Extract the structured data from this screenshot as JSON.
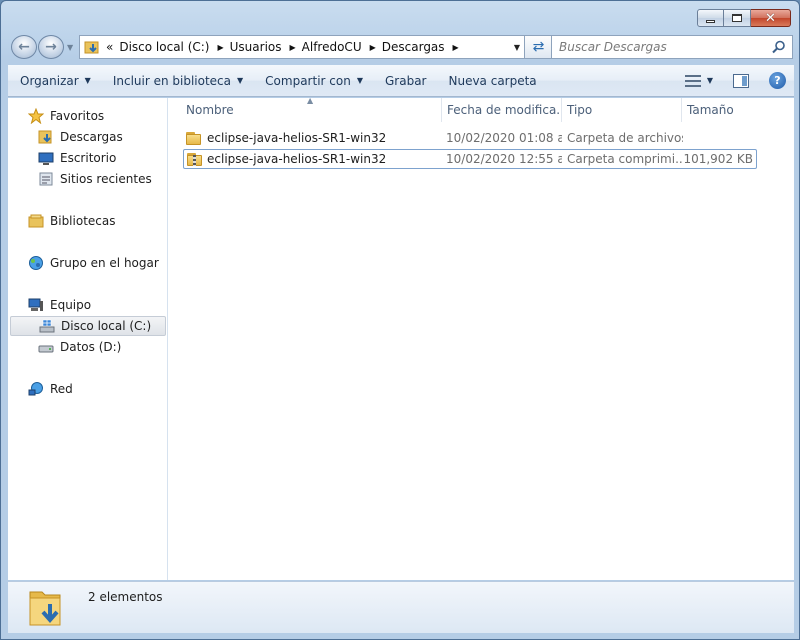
{
  "window": {
    "minimize_label": "–",
    "maximize_label": "□",
    "close_label": "✕"
  },
  "address": {
    "overflow_chevron": "«",
    "crumbs": [
      "Disco local (C:)",
      "Usuarios",
      "AlfredoCU",
      "Descargas"
    ]
  },
  "search": {
    "placeholder": "Buscar Descargas"
  },
  "toolbar": {
    "organize": "Organizar",
    "include": "Incluir en biblioteca",
    "share": "Compartir con",
    "burn": "Grabar",
    "new_folder": "Nueva carpeta"
  },
  "navpane": {
    "favorites": "Favoritos",
    "downloads": "Descargas",
    "desktop": "Escritorio",
    "recent": "Sitios recientes",
    "libraries": "Bibliotecas",
    "homegroup": "Grupo en el hogar",
    "computer": "Equipo",
    "local_disk": "Disco local (C:)",
    "data_disk": "Datos (D:)",
    "network": "Red"
  },
  "columns": {
    "name": "Nombre",
    "date": "Fecha de modifica...",
    "type": "Tipo",
    "size": "Tamaño"
  },
  "files": [
    {
      "name": "eclipse-java-helios-SR1-win32",
      "date": "10/02/2020 01:08 a...",
      "type": "Carpeta de archivos",
      "size": "",
      "icon": "folder-icon"
    },
    {
      "name": "eclipse-java-helios-SR1-win32",
      "date": "10/02/2020 12:55 a...",
      "type": "Carpeta comprimi...",
      "size": "101,902 KB",
      "icon": "zip-folder-icon"
    }
  ],
  "status": {
    "count": "2 elementos"
  },
  "colors": {
    "frame": "#b5cde6",
    "accent": "#1e395b",
    "folder": "#e6b94a",
    "selection_border": "#7da2ce"
  }
}
